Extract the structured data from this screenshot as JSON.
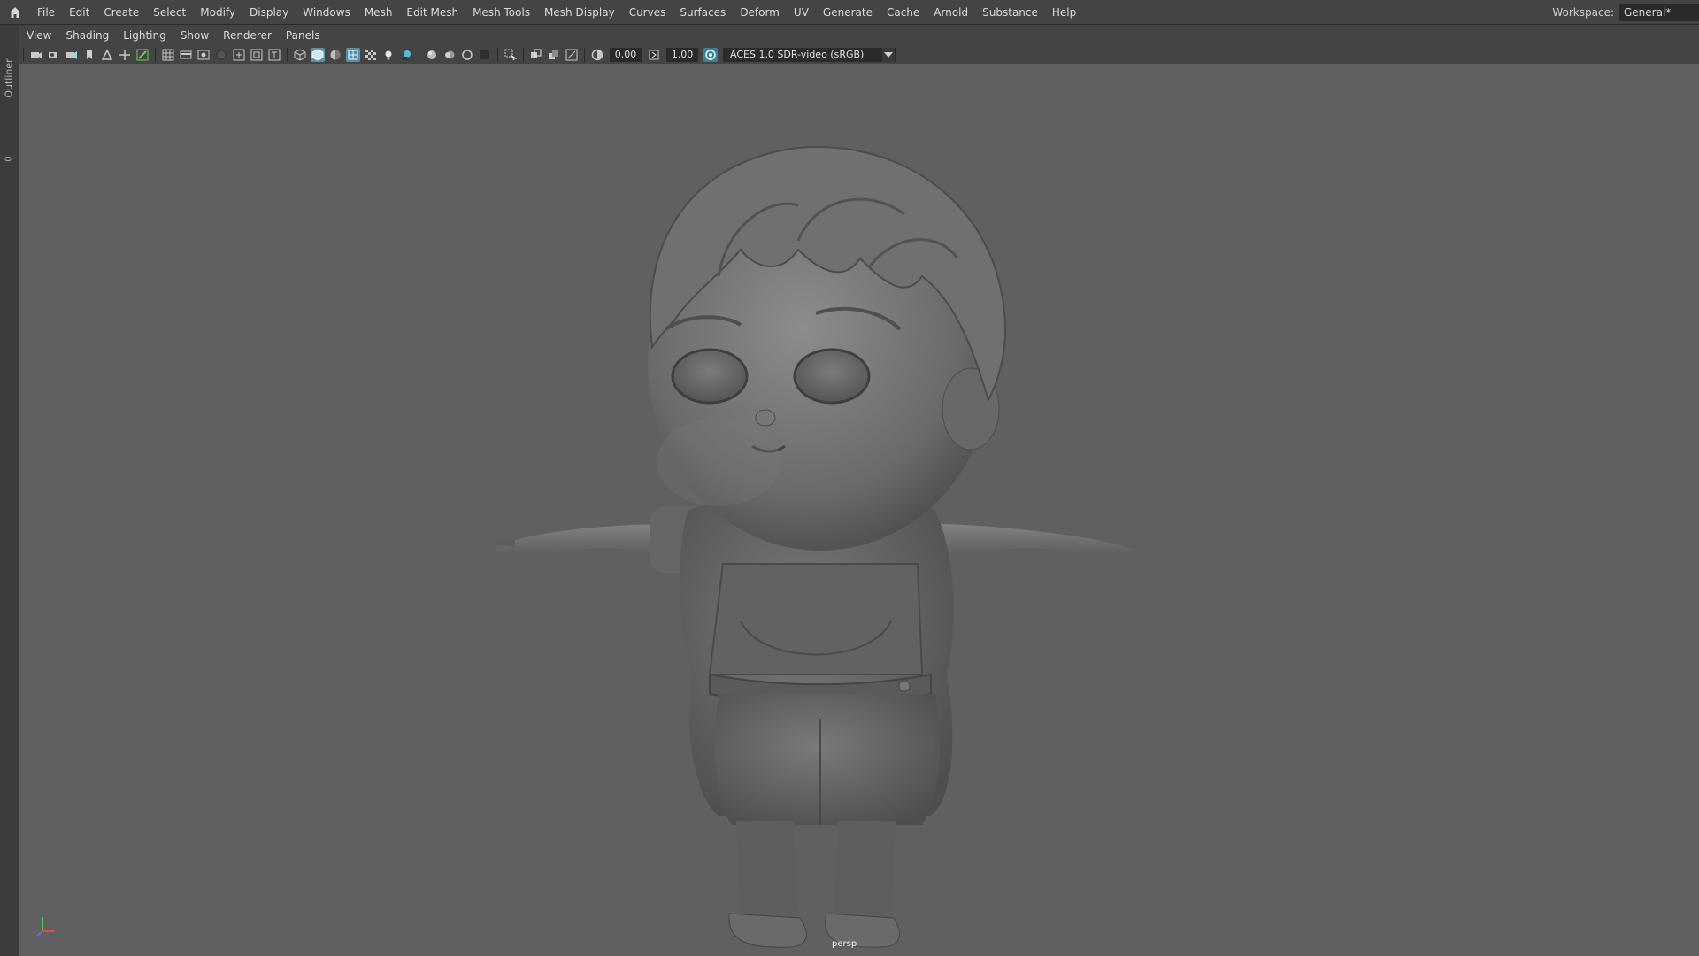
{
  "menubar": {
    "home_icon": "home-icon",
    "items": [
      "File",
      "Edit",
      "Create",
      "Select",
      "Modify",
      "Display",
      "Windows",
      "Mesh",
      "Edit Mesh",
      "Mesh Tools",
      "Mesh Display",
      "Curves",
      "Surfaces",
      "Deform",
      "UV",
      "Generate",
      "Cache",
      "Arnold",
      "Substance",
      "Help"
    ],
    "workspace_label": "Workspace:",
    "workspace_value": "General*"
  },
  "left_strip": {
    "outliner_label": "Outliner",
    "zero_label": "0"
  },
  "panel_menu": {
    "items": [
      "View",
      "Shading",
      "Lighting",
      "Show",
      "Renderer",
      "Panels"
    ]
  },
  "panel_toolbar": {
    "exposure": "0.00",
    "gamma": "1.00",
    "color_space": "ACES 1.0 SDR-video (sRGB)"
  },
  "viewport": {
    "camera_label": "persp",
    "background": "#606060"
  }
}
